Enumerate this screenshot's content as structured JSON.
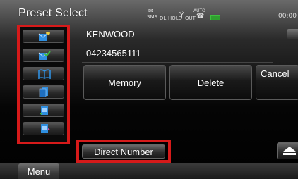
{
  "header": {
    "title": "Preset Select",
    "status": {
      "sms_top": "✉",
      "sms_bottom": "SMS",
      "dl": "DL",
      "hold": "HOLD",
      "antenna": "Ŷ",
      "out": "OUT",
      "auto": "AUTO",
      "car": "☎",
      "clock": "00:00"
    }
  },
  "icon_column": {
    "items": [
      {
        "icon": "contact-new-icon"
      },
      {
        "icon": "contact-check-icon"
      },
      {
        "icon": "phonebook-icon"
      },
      {
        "icon": "preset-list-icon"
      },
      {
        "icon": "incoming-call-icon"
      },
      {
        "icon": "outgoing-call-icon"
      }
    ]
  },
  "contact": {
    "name": "KENWOOD",
    "number": "04234565111"
  },
  "buttons": {
    "memory": "Memory",
    "delete": "Delete",
    "cancel": "Cancel",
    "direct_number": "Direct Number"
  },
  "footer": {
    "menu": "Menu"
  },
  "colors": {
    "highlight": "#d61a1a",
    "icon_blue": "#2f8fe0",
    "icon_green": "#3fbf3f",
    "battery": "#2f9f2f"
  }
}
